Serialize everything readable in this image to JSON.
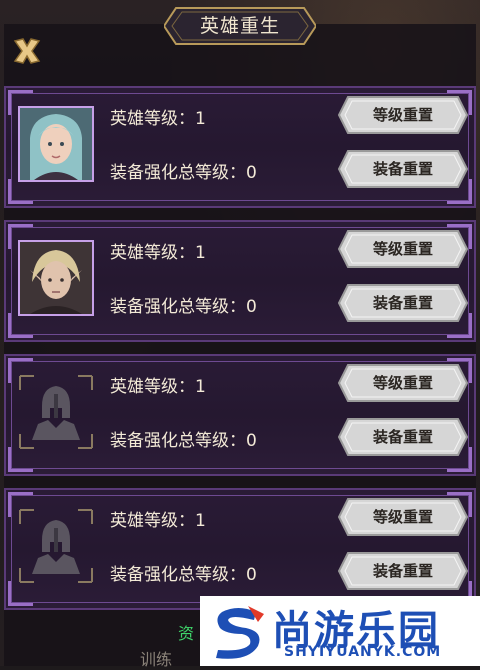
{
  "dialog": {
    "title": "英雄重生"
  },
  "heroes": [
    {
      "portrait": "hero-portrait-teal-hair",
      "level_label": "英雄等级：1",
      "equip_label": "装备强化总等级：0",
      "level_reset": "等级重置",
      "equip_reset": "装备重置"
    },
    {
      "portrait": "hero-portrait-blond-elf",
      "level_label": "英雄等级：1",
      "equip_label": "装备强化总等级：0",
      "level_reset": "等级重置",
      "equip_reset": "装备重置"
    },
    {
      "portrait": "empty-slot-helmet-icon",
      "level_label": "英雄等级：1",
      "equip_label": "装备强化总等级：0",
      "level_reset": "等级重置",
      "equip_reset": "装备重置"
    },
    {
      "portrait": "empty-slot-helmet-icon",
      "level_label": "英雄等级：1",
      "equip_label": "装备强化总等级：0",
      "level_reset": "等级重置",
      "equip_reset": "装备重置"
    }
  ],
  "background": {
    "bottom_left_text": "资",
    "bottom_left_text2": "训练"
  },
  "watermark": {
    "title": "尚游乐园",
    "url": "SHYIYUANYK.COM"
  },
  "colors": {
    "card_border": "#5a3a78",
    "button_silver": "#d8d8d8",
    "watermark_blue": "#1e4fb5",
    "title_gold": "#b89a5a"
  }
}
